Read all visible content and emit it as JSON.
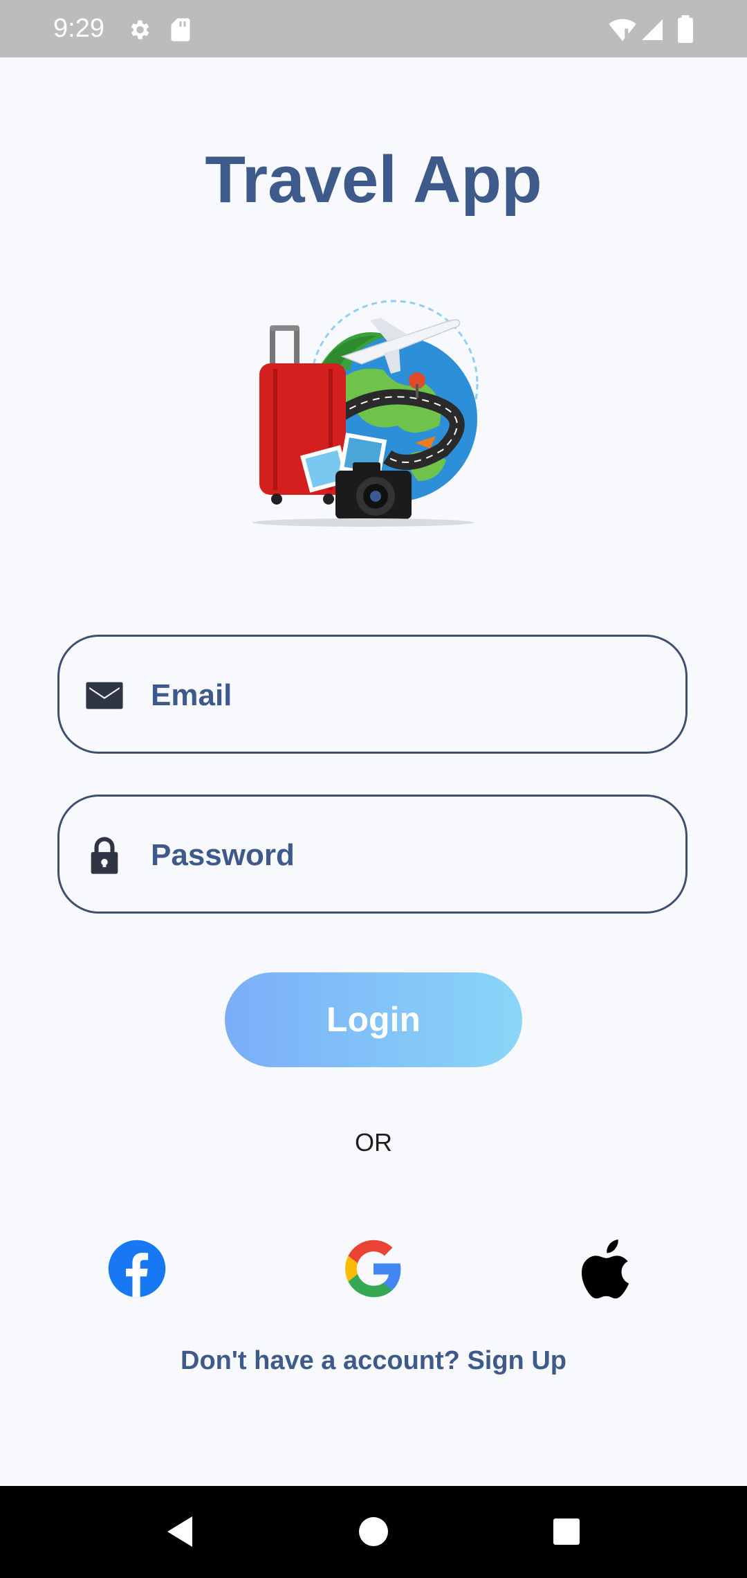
{
  "status_bar": {
    "time": "9:29",
    "icons": [
      "settings-gear-icon",
      "sd-card-icon",
      "wifi-icon",
      "signal-icon",
      "battery-icon"
    ]
  },
  "app": {
    "title": "Travel App",
    "illustration": "travel-illustration"
  },
  "form": {
    "email_placeholder": "Email",
    "email_value": "",
    "password_placeholder": "Password",
    "password_value": "",
    "login_label": "Login"
  },
  "divider_text": "OR",
  "social": [
    "facebook-icon",
    "google-icon",
    "apple-icon"
  ],
  "signup_text": "Don't have a account? Sign Up",
  "colors": {
    "primary": "#3e5a8a",
    "login_gradient_start": "#7aaef8",
    "login_gradient_end": "#8ad6f8",
    "background": "#f8f9fc",
    "status_bar": "#bcbcbe",
    "nav_bar": "#000000"
  },
  "nav": [
    "back-icon",
    "home-icon",
    "recents-icon"
  ]
}
